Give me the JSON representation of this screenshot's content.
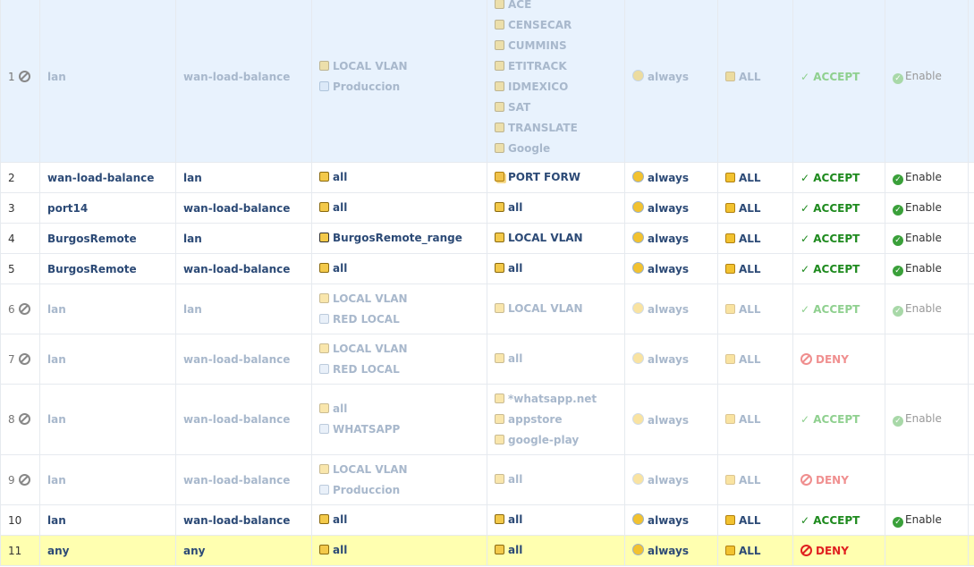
{
  "policies": [
    {
      "id": "1",
      "disabled": true,
      "src_if": "lan",
      "dst_if": "wan-load-balance",
      "source": [
        {
          "t": "addr",
          "n": "LOCAL VLAN"
        },
        {
          "t": "grp",
          "n": "Produccion"
        }
      ],
      "destination": [
        {
          "t": "addr",
          "n": "ACE"
        },
        {
          "t": "addr",
          "n": "CENSECAR"
        },
        {
          "t": "addr",
          "n": "CUMMINS"
        },
        {
          "t": "addr",
          "n": "ETITRACK"
        },
        {
          "t": "addr",
          "n": "IDMEXICO"
        },
        {
          "t": "addr",
          "n": "SAT"
        },
        {
          "t": "addr",
          "n": "TRANSLATE"
        },
        {
          "t": "addr",
          "n": "Google"
        }
      ],
      "schedule": "always",
      "service": "ALL",
      "action": "ACCEPT",
      "nat": "Enable"
    },
    {
      "id": "2",
      "src_if": "wan-load-balance",
      "dst_if": "lan",
      "source": [
        {
          "t": "addr",
          "n": "all"
        }
      ],
      "destination": [
        {
          "t": "vip",
          "n": "PORT FORW"
        }
      ],
      "schedule": "always",
      "service": "ALL",
      "action": "ACCEPT",
      "nat": "Enable"
    },
    {
      "id": "3",
      "src_if": "port14",
      "dst_if": "wan-load-balance",
      "source": [
        {
          "t": "addr",
          "n": "all"
        }
      ],
      "destination": [
        {
          "t": "addr",
          "n": "all"
        }
      ],
      "schedule": "always",
      "service": "ALL",
      "action": "ACCEPT",
      "nat": "Enable"
    },
    {
      "id": "4",
      "src_if": "BurgosRemote",
      "dst_if": "lan",
      "source": [
        {
          "t": "range",
          "n": "BurgosRemote_range"
        }
      ],
      "destination": [
        {
          "t": "addr",
          "n": "LOCAL VLAN"
        }
      ],
      "schedule": "always",
      "service": "ALL",
      "action": "ACCEPT",
      "nat": "Enable"
    },
    {
      "id": "5",
      "src_if": "BurgosRemote",
      "dst_if": "wan-load-balance",
      "source": [
        {
          "t": "addr",
          "n": "all"
        }
      ],
      "destination": [
        {
          "t": "addr",
          "n": "all"
        }
      ],
      "schedule": "always",
      "service": "ALL",
      "action": "ACCEPT",
      "nat": "Enable"
    },
    {
      "id": "6",
      "disabled": true,
      "src_if": "lan",
      "dst_if": "lan",
      "source": [
        {
          "t": "addr",
          "n": "LOCAL VLAN"
        },
        {
          "t": "grp",
          "n": "RED LOCAL"
        }
      ],
      "destination": [
        {
          "t": "addr",
          "n": "LOCAL VLAN"
        }
      ],
      "schedule": "always",
      "service": "ALL",
      "action": "ACCEPT",
      "nat": "Enable"
    },
    {
      "id": "7",
      "disabled": true,
      "src_if": "lan",
      "dst_if": "wan-load-balance",
      "source": [
        {
          "t": "addr",
          "n": "LOCAL VLAN"
        },
        {
          "t": "grp",
          "n": "RED LOCAL"
        }
      ],
      "destination": [
        {
          "t": "addr",
          "n": "all"
        }
      ],
      "schedule": "always",
      "service": "ALL",
      "action": "DENY",
      "nat": ""
    },
    {
      "id": "8",
      "disabled": true,
      "src_if": "lan",
      "dst_if": "wan-load-balance",
      "source": [
        {
          "t": "addr",
          "n": "all"
        },
        {
          "t": "grp",
          "n": "WHATSAPP"
        }
      ],
      "destination": [
        {
          "t": "addr",
          "n": "*whatsapp.net"
        },
        {
          "t": "addr",
          "n": "appstore"
        },
        {
          "t": "addr",
          "n": "google-play"
        }
      ],
      "schedule": "always",
      "service": "ALL",
      "action": "ACCEPT",
      "nat": "Enable"
    },
    {
      "id": "9",
      "disabled": true,
      "src_if": "lan",
      "dst_if": "wan-load-balance",
      "source": [
        {
          "t": "addr",
          "n": "LOCAL VLAN"
        },
        {
          "t": "grp",
          "n": "Produccion"
        }
      ],
      "destination": [
        {
          "t": "addr",
          "n": "all"
        }
      ],
      "schedule": "always",
      "service": "ALL",
      "action": "DENY",
      "nat": ""
    },
    {
      "id": "10",
      "src_if": "lan",
      "dst_if": "wan-load-balance",
      "source": [
        {
          "t": "addr",
          "n": "all"
        }
      ],
      "destination": [
        {
          "t": "addr",
          "n": "all"
        }
      ],
      "schedule": "always",
      "service": "ALL",
      "action": "ACCEPT",
      "nat": "Enable"
    },
    {
      "id": "11",
      "src_if": "any",
      "dst_if": "any",
      "source": [
        {
          "t": "addr",
          "n": "all"
        }
      ],
      "destination": [
        {
          "t": "addr",
          "n": "all"
        }
      ],
      "schedule": "always",
      "service": "ALL",
      "action": "DENY",
      "nat": ""
    }
  ]
}
